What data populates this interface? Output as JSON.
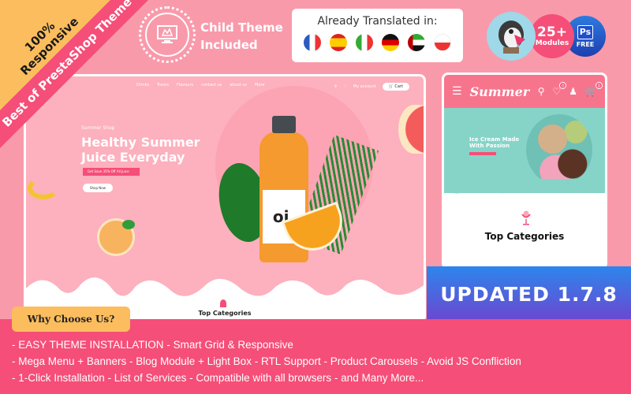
{
  "corner": {
    "responsive_line1": "100%",
    "responsive_line2": "Responsive",
    "ribbon": "Best of PrestaShop Theme"
  },
  "child_theme": {
    "line1": "Child Theme",
    "line2": "Included"
  },
  "translated": {
    "title": "Already Translated in:",
    "flags": [
      "french-flag",
      "spanish-flag",
      "italian-flag",
      "german-flag",
      "uae-flag",
      "polish-flag"
    ]
  },
  "badges": {
    "modules_count": "25+",
    "modules_label": "Modules",
    "ps_label": "Ps",
    "ps_free": "FREE"
  },
  "desktop": {
    "nav": [
      "Drinks",
      "Treats",
      "Flavours",
      "contact us",
      "about us",
      "More"
    ],
    "account": "My account",
    "cart": "Cart",
    "subtitle": "Summer Shop",
    "headline_line1": "Healthy Summer",
    "headline_line2": "Juice Everyday",
    "promo": "Get Save 35% Off All Juice",
    "shop_button": "Shop Now",
    "bottle_label": "oj.",
    "top_categories": "Top Categories"
  },
  "mobile": {
    "logo": "Summer",
    "wishlist_count": "0",
    "cart_count": "0",
    "hero_line1": "Ice Cream Made",
    "hero_line2": "With Passion",
    "top_categories": "Top Categories"
  },
  "updated": "UPDATED 1.7.8",
  "why_choose": "Why Choose Us?",
  "features": [
    [
      "EASY THEME INSTALLATION",
      "Smart Grid & Responsive"
    ],
    [
      "Mega Menu + Banners",
      "Blog Module + Light Box",
      "RTL Support",
      "Product Carousels",
      "Avoid JS Confliction"
    ],
    [
      "1-Click Installation",
      "List of Services",
      "Compatible with all browsers",
      "and Many More..."
    ]
  ],
  "colors": {
    "background": "#f99aab",
    "brand_pink": "#f54e78",
    "yellow": "#fbbd5e",
    "mint": "#86d4c8",
    "blue_start": "#2d86ec",
    "purple_end": "#6c46d0"
  }
}
